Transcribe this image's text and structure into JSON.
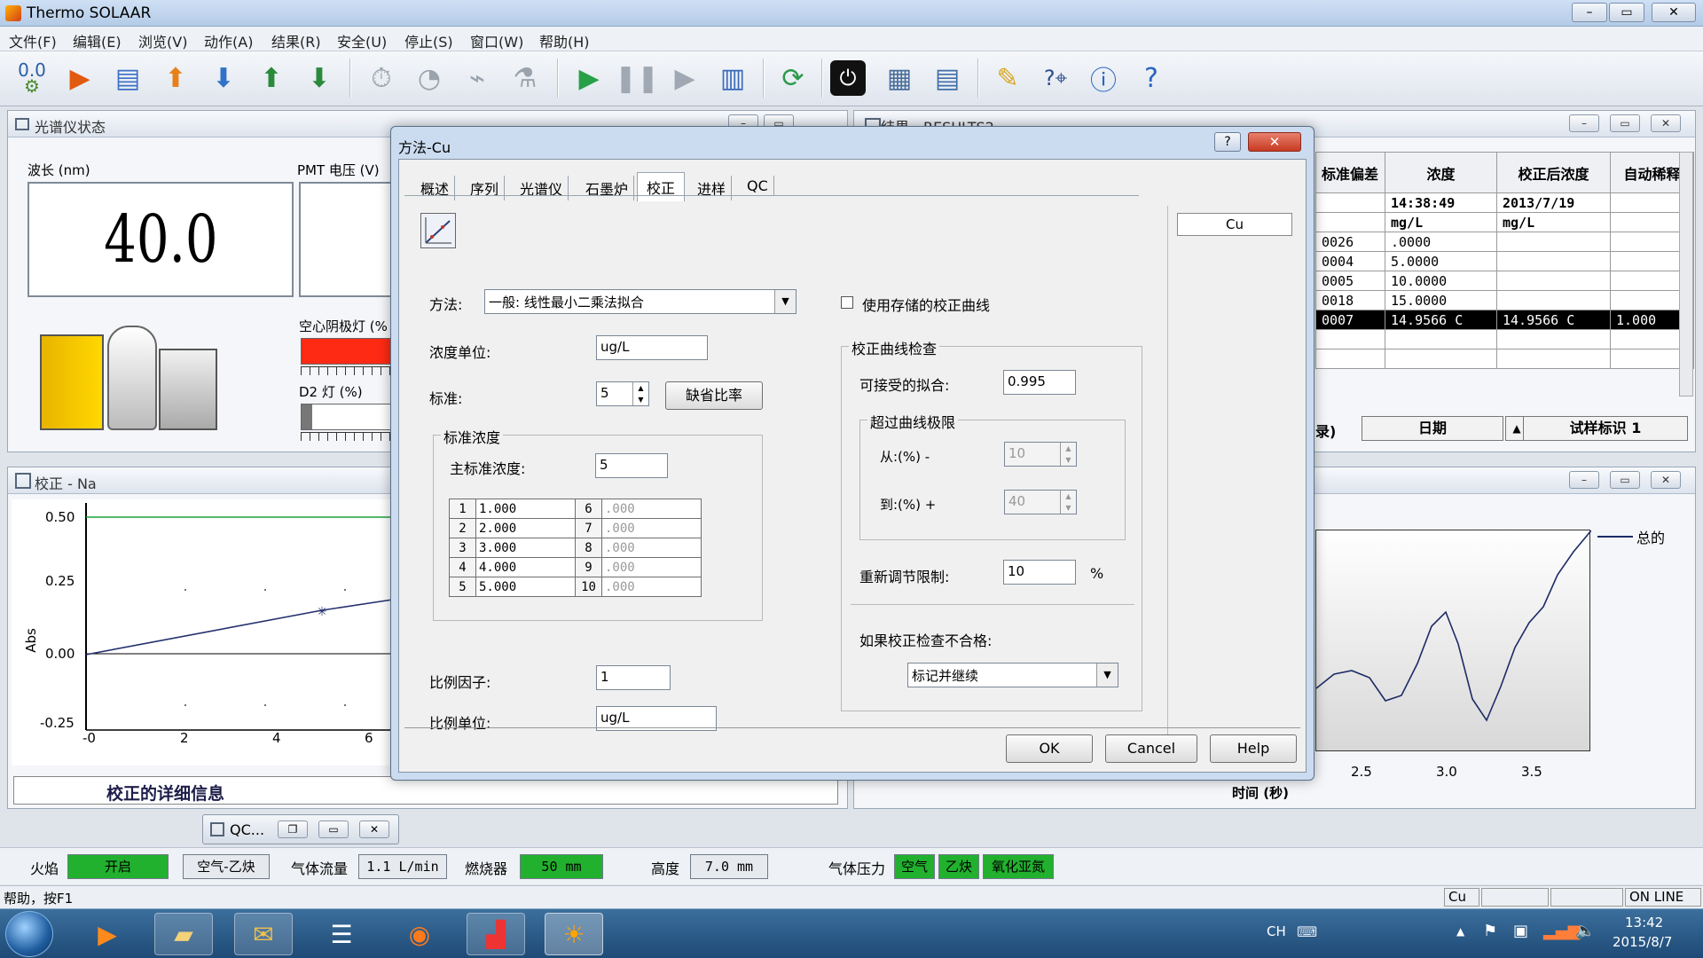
{
  "window": {
    "title": "Thermo SOLAAR"
  },
  "menu": [
    "文件(F)",
    "编辑(E)",
    "浏览(V)",
    "动作(A)",
    "结果(R)",
    "安全(U)",
    "停止(S)",
    "窗口(W)",
    "帮助(H)"
  ],
  "toolbar": {
    "zero_label": "0.0"
  },
  "spectro_panel": {
    "title": "光谱仪状态",
    "wavelength_label": "波长 (nm)",
    "wavelength_value": "40.0",
    "pmt_label": "PMT 电压 (V)",
    "hcl_label": "空心阴极灯 (%",
    "d2_label": "D2 灯 (%)",
    "hcl_color": "#ff2a14"
  },
  "results_panel": {
    "title": "结果 - RESULTS2 - ...",
    "headers": [
      "标准偏差",
      "浓度",
      "校正后浓度",
      "自动稀释"
    ],
    "rows": [
      [
        "",
        "14:38:49",
        "2013/7/19",
        ""
      ],
      [
        "",
        "mg/L",
        "mg/L",
        ""
      ],
      [
        "0026",
        ".0000",
        "",
        ""
      ],
      [
        "0004",
        "5.0000",
        "",
        ""
      ],
      [
        "0005",
        "10.0000",
        "",
        ""
      ],
      [
        "0018",
        "15.0000",
        "",
        ""
      ],
      [
        "0007",
        "14.9566 C",
        "14.9566 C",
        "1.000"
      ],
      [
        "",
        "",
        "",
        ""
      ],
      [
        "",
        "",
        "",
        ""
      ]
    ],
    "footer_left": "录)",
    "footer_date": "日期",
    "footer_sample": "试样标识 1"
  },
  "calib_panel": {
    "title": "校正 - Na",
    "ylabel": "Abs",
    "yticks": [
      "0.50",
      "0.25",
      "0.00",
      "-0.25"
    ],
    "xticks": [
      "-0",
      "2",
      "4",
      "6"
    ],
    "details_label": "校正的详细信息"
  },
  "signal_panel": {
    "legend": "总的",
    "xticks": [
      "2.5",
      "3.0",
      "3.5"
    ],
    "xlabel": "时间 (秒)"
  },
  "qc_minimized": {
    "label": "QC..."
  },
  "dialog": {
    "title": "方法-Cu",
    "tabs": [
      "概述",
      "序列",
      "光谱仪",
      "石墨炉",
      "校正",
      "进样",
      "QC"
    ],
    "active_tab": "校正",
    "element_list": [
      "Cu"
    ],
    "method_label": "方法:",
    "method_value": "一般: 线性最小二乘法拟合",
    "conc_unit_label": "浓度单位:",
    "conc_unit_value": "ug/L",
    "standards_label": "标准:",
    "standards_value": "5",
    "default_ratio_btn": "缺省比率",
    "std_conc_group": "标准浓度",
    "master_std_label": "主标准浓度:",
    "master_std_value": "5",
    "std_table_left": [
      [
        "1",
        "1.000"
      ],
      [
        "2",
        "2.000"
      ],
      [
        "3",
        "3.000"
      ],
      [
        "4",
        "4.000"
      ],
      [
        "5",
        "5.000"
      ]
    ],
    "std_table_right": [
      [
        "6",
        ".000"
      ],
      [
        "7",
        ".000"
      ],
      [
        "8",
        ".000"
      ],
      [
        "9",
        ".000"
      ],
      [
        "10",
        ".000"
      ]
    ],
    "scale_factor_label": "比例因子:",
    "scale_factor_value": "1",
    "scale_unit_label": "比例单位:",
    "scale_unit_value": "ug/L",
    "use_stored_curve": "使用存储的校正曲线",
    "curve_check_group": "校正曲线检查",
    "acceptable_fit_label": "可接受的拟合:",
    "acceptable_fit_value": "0.995",
    "exceed_limits_group": "超过曲线极限",
    "from_label": "从:(%) -",
    "from_value": "10",
    "to_label": "到:(%) +",
    "to_value": "40",
    "reslope_label": "重新调节限制:",
    "reslope_value": "10",
    "reslope_unit": "%",
    "fail_label": "如果校正检查不合格:",
    "fail_value": "标记并继续",
    "ok": "OK",
    "cancel": "Cancel",
    "help": "Help"
  },
  "device_bar": {
    "flame_label": "火焰",
    "flame_value": "开启",
    "gas_value": "空气-乙炔",
    "flow_label": "气体流量",
    "flow_value": "1.1 L/min",
    "burner_label": "燃烧器",
    "burner_value": "50 mm",
    "height_label": "高度",
    "height_value": "7.0 mm",
    "pressure_label": "气体压力",
    "pressure_items": [
      "空气",
      "乙炔",
      "氧化亚氮"
    ],
    "green": "#22b12e"
  },
  "status_bar": {
    "help": "帮助，按F1",
    "element": "Cu",
    "online": "ON LINE"
  },
  "taskbar": {
    "lang": "CH",
    "time": "13:42",
    "date": "2015/8/7"
  }
}
